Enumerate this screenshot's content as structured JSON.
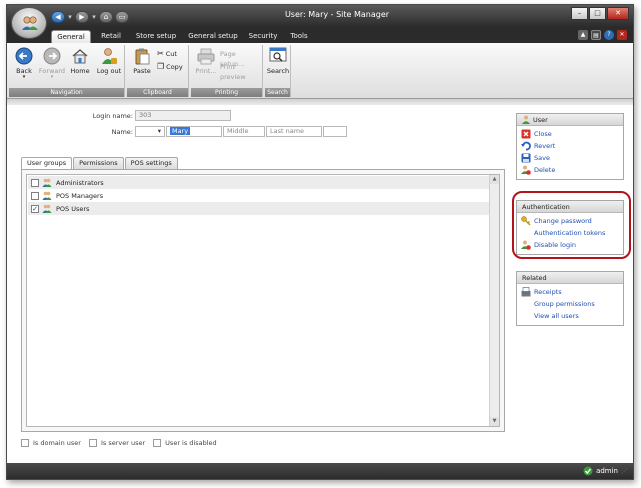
{
  "window": {
    "title": "User: Mary - Site Manager"
  },
  "ribbon_tabs": [
    "General",
    "Retail",
    "Store setup",
    "General setup",
    "Security",
    "Tools"
  ],
  "ribbon": {
    "navigation": {
      "label": "Navigation",
      "back": "Back",
      "forward": "Forward",
      "home": "Home",
      "logout": "Log out"
    },
    "clipboard": {
      "label": "Clipboard",
      "paste": "Paste",
      "cut": "Cut",
      "copy": "Copy"
    },
    "printing": {
      "label": "Printing",
      "print": "Print...",
      "page_setup": "Page setup...",
      "print_preview": "Print preview"
    },
    "search": {
      "label": "Search",
      "search": "Search"
    }
  },
  "form": {
    "login_name_label": "Login name:",
    "login_name_value": "303",
    "name_label": "Name:",
    "first_name_value": "Mary",
    "middle_placeholder": "Middle",
    "last_name_placeholder": "Last name"
  },
  "content_tabs": [
    "User groups",
    "Permissions",
    "POS settings"
  ],
  "user_groups": [
    {
      "name": "Administrators",
      "checked": false
    },
    {
      "name": "POS Managers",
      "checked": false
    },
    {
      "name": "POS Users",
      "checked": true
    }
  ],
  "bottom_checkboxes": [
    "Is domain user",
    "Is server user",
    "User is disabled"
  ],
  "panels": {
    "user": {
      "title": "User",
      "items": [
        "Close",
        "Revert",
        "Save",
        "Delete"
      ]
    },
    "authentication": {
      "title": "Authentication",
      "items": [
        "Change password",
        "Authentication tokens",
        "Disable login"
      ]
    },
    "related": {
      "title": "Related",
      "items": [
        "Receipts",
        "Group permissions",
        "View all users"
      ]
    }
  },
  "status": {
    "user": "admin"
  },
  "colors": {
    "accent": "#1f4fb0",
    "highlight": "#b3141b",
    "selection": "#3a78d8"
  }
}
